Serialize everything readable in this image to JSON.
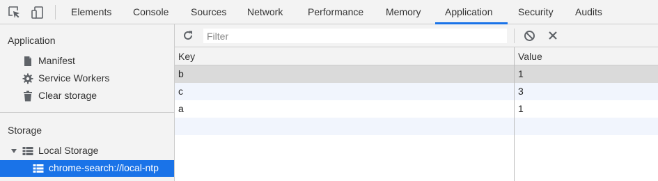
{
  "toolbar": {
    "tabs": [
      {
        "label": "Elements"
      },
      {
        "label": "Console"
      },
      {
        "label": "Sources"
      },
      {
        "label": "Network"
      },
      {
        "label": "Performance"
      },
      {
        "label": "Memory"
      },
      {
        "label": "Application",
        "active": true
      },
      {
        "label": "Security"
      },
      {
        "label": "Audits"
      }
    ],
    "icons": [
      "inspect-element-icon",
      "device-toolbar-icon"
    ],
    "accent_color": "#1a73e8"
  },
  "sidebar": {
    "application": {
      "title": "Application",
      "items": [
        {
          "label": "Manifest",
          "icon": "document-icon"
        },
        {
          "label": "Service Workers",
          "icon": "gear-icon"
        },
        {
          "label": "Clear storage",
          "icon": "trash-icon"
        }
      ]
    },
    "storage": {
      "title": "Storage",
      "items": [
        {
          "label": "Local Storage",
          "icon": "grid-icon",
          "expanded": true
        },
        {
          "label": "chrome-search://local-ntp",
          "icon": "grid-icon",
          "selected": true
        }
      ]
    }
  },
  "filterbar": {
    "placeholder": "Filter",
    "value": "",
    "icons": [
      "refresh-icon",
      "clear-all-icon",
      "delete-selected-icon"
    ]
  },
  "table": {
    "columns": [
      "Key",
      "Value"
    ],
    "rows": [
      {
        "key": "b",
        "value": "1",
        "selected": true
      },
      {
        "key": "c",
        "value": "3"
      },
      {
        "key": "a",
        "value": "1"
      }
    ]
  }
}
